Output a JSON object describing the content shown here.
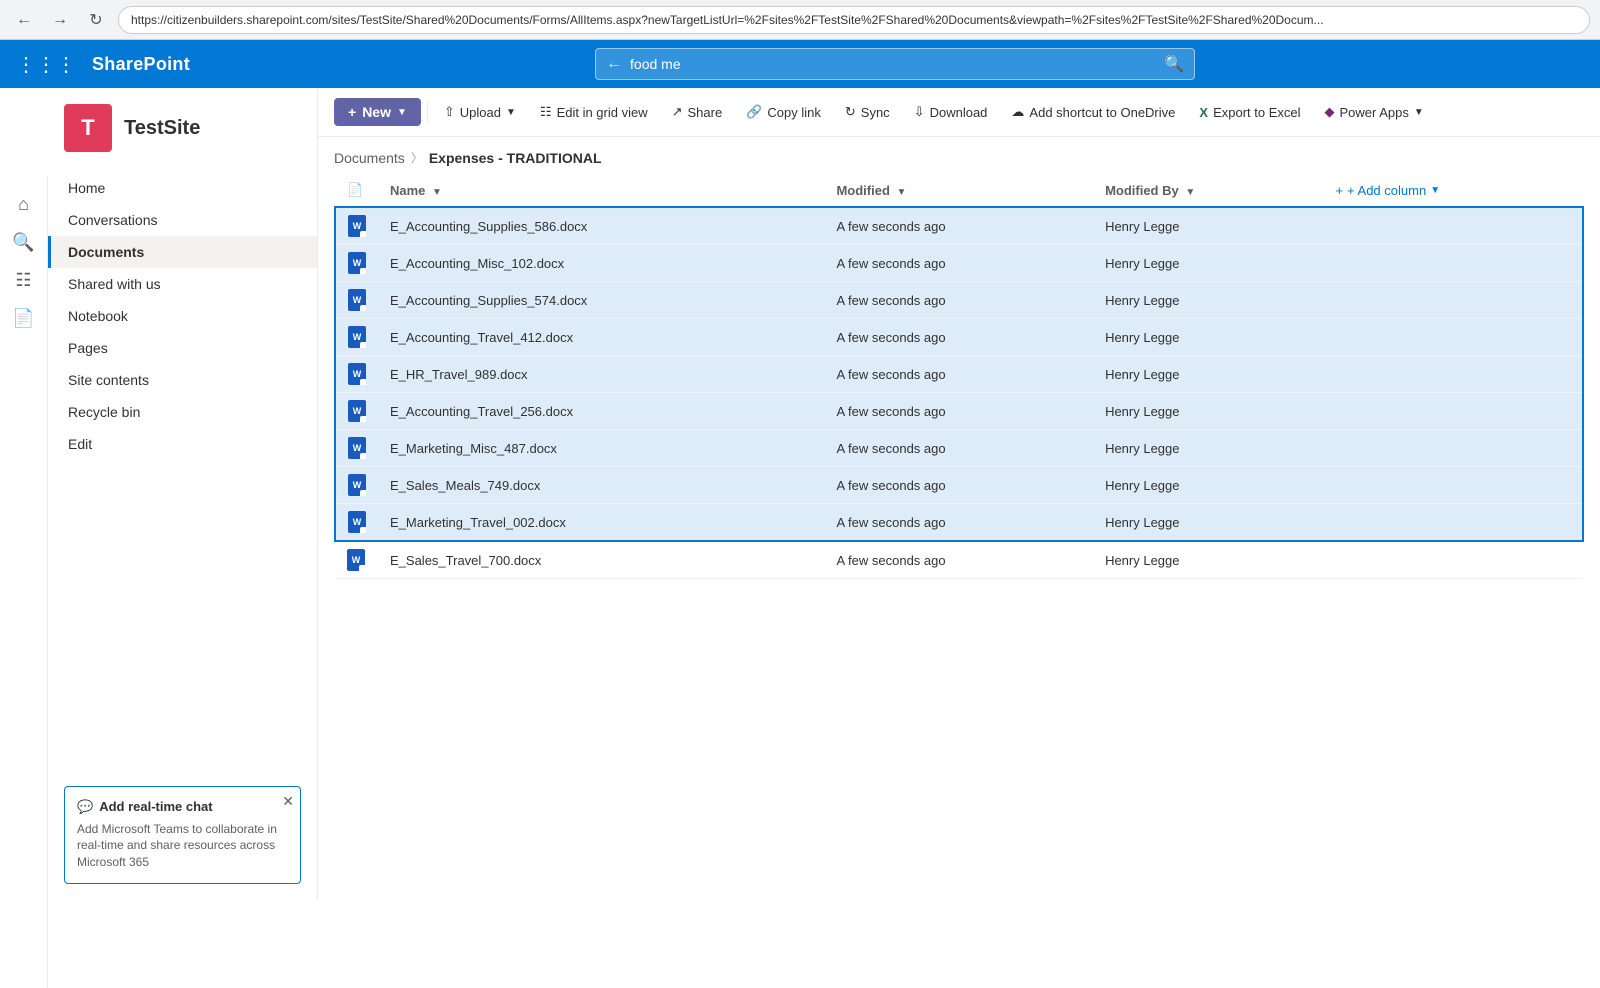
{
  "browser": {
    "url": "https://citizenbuilders.sharepoint.com/sites/TestSite/Shared%20Documents/Forms/AllItems.aspx?newTargetListUrl=%2Fsites%2FTestSite%2FShared%20Documents&viewpath=%2Fsites%2FTestSite%2FShared%20Docum..."
  },
  "header": {
    "app_name": "SharePoint",
    "search_value": "food me",
    "search_placeholder": "Search"
  },
  "site": {
    "logo_letter": "T",
    "name": "TestSite"
  },
  "nav": {
    "items": [
      {
        "label": "Home",
        "active": false
      },
      {
        "label": "Conversations",
        "active": false
      },
      {
        "label": "Documents",
        "active": true
      },
      {
        "label": "Shared with us",
        "active": false
      },
      {
        "label": "Notebook",
        "active": false
      },
      {
        "label": "Pages",
        "active": false
      },
      {
        "label": "Site contents",
        "active": false
      },
      {
        "label": "Recycle bin",
        "active": false
      },
      {
        "label": "Edit",
        "active": false
      }
    ]
  },
  "sidebar_promo": {
    "title": "Add real-time chat",
    "icon": "💬",
    "text": "Add Microsoft Teams to collaborate in real-time and share resources across Microsoft 365"
  },
  "toolbar": {
    "new_label": "New",
    "upload_label": "Upload",
    "edit_in_grid_label": "Edit in grid view",
    "share_label": "Share",
    "copy_link_label": "Copy link",
    "sync_label": "Sync",
    "download_label": "Download",
    "add_shortcut_label": "Add shortcut to OneDrive",
    "export_excel_label": "Export to Excel",
    "power_apps_label": "Power Apps"
  },
  "breadcrumb": {
    "parent": "Documents",
    "current": "Expenses - TRADITIONAL"
  },
  "table": {
    "col_type": "",
    "col_name": "Name",
    "col_modified": "Modified",
    "col_modified_by": "Modified By",
    "col_add": "+ Add column",
    "files": [
      {
        "name": "E_Accounting_Supplies_586.docx",
        "modified": "A few seconds ago",
        "modified_by": "Henry Legge",
        "selected": true
      },
      {
        "name": "E_Accounting_Misc_102.docx",
        "modified": "A few seconds ago",
        "modified_by": "Henry Legge",
        "selected": true
      },
      {
        "name": "E_Accounting_Supplies_574.docx",
        "modified": "A few seconds ago",
        "modified_by": "Henry Legge",
        "selected": true
      },
      {
        "name": "E_Accounting_Travel_412.docx",
        "modified": "A few seconds ago",
        "modified_by": "Henry Legge",
        "selected": true
      },
      {
        "name": "E_HR_Travel_989.docx",
        "modified": "A few seconds ago",
        "modified_by": "Henry Legge",
        "selected": true
      },
      {
        "name": "E_Accounting_Travel_256.docx",
        "modified": "A few seconds ago",
        "modified_by": "Henry Legge",
        "selected": true
      },
      {
        "name": "E_Marketing_Misc_487.docx",
        "modified": "A few seconds ago",
        "modified_by": "Henry Legge",
        "selected": true
      },
      {
        "name": "E_Sales_Meals_749.docx",
        "modified": "A few seconds ago",
        "modified_by": "Henry Legge",
        "selected": true
      },
      {
        "name": "E_Marketing_Travel_002.docx",
        "modified": "A few seconds ago",
        "modified_by": "Henry Legge",
        "selected": true
      },
      {
        "name": "E_Sales_Travel_700.docx",
        "modified": "A few seconds ago",
        "modified_by": "Henry Legge",
        "selected": false
      }
    ]
  }
}
